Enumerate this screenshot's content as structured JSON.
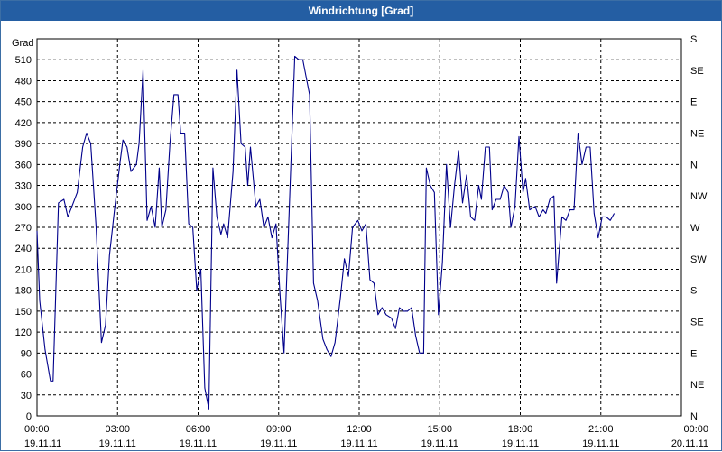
{
  "window": {
    "title": "Windrichtung [Grad]"
  },
  "chart_data": {
    "type": "line",
    "title": "Windrichtung [Grad]",
    "ylabel": "Grad",
    "ylim": [
      0,
      540
    ],
    "xlim": [
      "19.11.11 00:00",
      "20.11.11 00:00"
    ],
    "grid": true,
    "y_ticks": [
      0,
      30,
      60,
      90,
      120,
      150,
      180,
      210,
      240,
      270,
      300,
      330,
      360,
      390,
      420,
      450,
      480,
      510
    ],
    "y2_ticks": [
      {
        "value": 0,
        "label": "N"
      },
      {
        "value": 45,
        "label": "NE"
      },
      {
        "value": 90,
        "label": "E"
      },
      {
        "value": 135,
        "label": "SE"
      },
      {
        "value": 180,
        "label": "S"
      },
      {
        "value": 225,
        "label": "SW"
      },
      {
        "value": 270,
        "label": "W"
      },
      {
        "value": 315,
        "label": "NW"
      },
      {
        "value": 360,
        "label": "N"
      },
      {
        "value": 405,
        "label": "NE"
      },
      {
        "value": 450,
        "label": "E"
      },
      {
        "value": 495,
        "label": "SE"
      },
      {
        "value": 540,
        "label": "S"
      }
    ],
    "x_ticks": [
      {
        "hour": 0,
        "time": "00:00",
        "date": "19.11.11"
      },
      {
        "hour": 3,
        "time": "03:00",
        "date": "19.11.11"
      },
      {
        "hour": 6,
        "time": "06:00",
        "date": "19.11.11"
      },
      {
        "hour": 9,
        "time": "09:00",
        "date": "19.11.11"
      },
      {
        "hour": 12,
        "time": "12:00",
        "date": "19.11.11"
      },
      {
        "hour": 15,
        "time": "15:00",
        "date": "19.11.11"
      },
      {
        "hour": 18,
        "time": "18:00",
        "date": "19.11.11"
      },
      {
        "hour": 21,
        "time": "21:00",
        "date": "19.11.11"
      },
      {
        "hour": 24,
        "time": "00:00",
        "date": "20.11.11"
      }
    ],
    "series": [
      {
        "color": "#00008b",
        "points": [
          [
            0.0,
            265
          ],
          [
            0.1,
            165
          ],
          [
            0.3,
            95
          ],
          [
            0.5,
            50
          ],
          [
            0.6,
            50
          ],
          [
            0.8,
            305
          ],
          [
            1.0,
            310
          ],
          [
            1.15,
            285
          ],
          [
            1.3,
            300
          ],
          [
            1.5,
            320
          ],
          [
            1.7,
            385
          ],
          [
            1.85,
            405
          ],
          [
            2.0,
            390
          ],
          [
            2.2,
            270
          ],
          [
            2.4,
            105
          ],
          [
            2.55,
            130
          ],
          [
            2.7,
            230
          ],
          [
            2.9,
            300
          ],
          [
            3.1,
            365
          ],
          [
            3.2,
            395
          ],
          [
            3.35,
            385
          ],
          [
            3.5,
            350
          ],
          [
            3.7,
            360
          ],
          [
            3.8,
            390
          ],
          [
            3.95,
            495
          ],
          [
            4.1,
            280
          ],
          [
            4.25,
            300
          ],
          [
            4.4,
            270
          ],
          [
            4.55,
            355
          ],
          [
            4.65,
            270
          ],
          [
            4.8,
            295
          ],
          [
            4.95,
            390
          ],
          [
            5.1,
            460
          ],
          [
            5.25,
            460
          ],
          [
            5.35,
            405
          ],
          [
            5.5,
            405
          ],
          [
            5.65,
            275
          ],
          [
            5.8,
            270
          ],
          [
            5.95,
            180
          ],
          [
            6.1,
            210
          ],
          [
            6.25,
            40
          ],
          [
            6.4,
            10
          ],
          [
            6.55,
            355
          ],
          [
            6.7,
            285
          ],
          [
            6.85,
            260
          ],
          [
            6.95,
            275
          ],
          [
            7.1,
            255
          ],
          [
            7.3,
            350
          ],
          [
            7.45,
            495
          ],
          [
            7.6,
            390
          ],
          [
            7.75,
            385
          ],
          [
            7.85,
            330
          ],
          [
            7.95,
            385
          ],
          [
            8.15,
            300
          ],
          [
            8.3,
            310
          ],
          [
            8.45,
            270
          ],
          [
            8.6,
            285
          ],
          [
            8.75,
            255
          ],
          [
            8.9,
            275
          ],
          [
            9.05,
            175
          ],
          [
            9.2,
            90
          ],
          [
            9.4,
            300
          ],
          [
            9.6,
            515
          ],
          [
            9.75,
            510
          ],
          [
            9.9,
            510
          ],
          [
            10.0,
            490
          ],
          [
            10.15,
            460
          ],
          [
            10.3,
            190
          ],
          [
            10.45,
            165
          ],
          [
            10.65,
            110
          ],
          [
            10.8,
            95
          ],
          [
            10.95,
            85
          ],
          [
            11.1,
            105
          ],
          [
            11.3,
            170
          ],
          [
            11.45,
            225
          ],
          [
            11.6,
            200
          ],
          [
            11.75,
            270
          ],
          [
            11.95,
            280
          ],
          [
            12.1,
            265
          ],
          [
            12.25,
            275
          ],
          [
            12.4,
            195
          ],
          [
            12.55,
            190
          ],
          [
            12.7,
            145
          ],
          [
            12.85,
            155
          ],
          [
            13.0,
            145
          ],
          [
            13.2,
            140
          ],
          [
            13.35,
            125
          ],
          [
            13.5,
            155
          ],
          [
            13.65,
            150
          ],
          [
            13.8,
            150
          ],
          [
            13.95,
            155
          ],
          [
            14.1,
            115
          ],
          [
            14.25,
            90
          ],
          [
            14.4,
            90
          ],
          [
            14.5,
            355
          ],
          [
            14.65,
            330
          ],
          [
            14.8,
            320
          ],
          [
            14.95,
            145
          ],
          [
            15.1,
            220
          ],
          [
            15.25,
            360
          ],
          [
            15.4,
            270
          ],
          [
            15.55,
            330
          ],
          [
            15.7,
            380
          ],
          [
            15.85,
            305
          ],
          [
            16.0,
            345
          ],
          [
            16.15,
            285
          ],
          [
            16.3,
            280
          ],
          [
            16.45,
            330
          ],
          [
            16.55,
            310
          ],
          [
            16.7,
            385
          ],
          [
            16.85,
            385
          ],
          [
            16.95,
            295
          ],
          [
            17.1,
            310
          ],
          [
            17.25,
            310
          ],
          [
            17.4,
            330
          ],
          [
            17.55,
            320
          ],
          [
            17.65,
            270
          ],
          [
            17.8,
            300
          ],
          [
            17.95,
            400
          ],
          [
            18.1,
            320
          ],
          [
            18.2,
            340
          ],
          [
            18.35,
            295
          ],
          [
            18.55,
            300
          ],
          [
            18.7,
            285
          ],
          [
            18.85,
            295
          ],
          [
            18.95,
            290
          ],
          [
            19.1,
            310
          ],
          [
            19.25,
            315
          ],
          [
            19.35,
            190
          ],
          [
            19.55,
            285
          ],
          [
            19.7,
            280
          ],
          [
            19.85,
            295
          ],
          [
            20.0,
            295
          ],
          [
            20.15,
            405
          ],
          [
            20.3,
            360
          ],
          [
            20.45,
            385
          ],
          [
            20.6,
            385
          ],
          [
            20.75,
            290
          ],
          [
            20.9,
            255
          ],
          [
            21.05,
            285
          ],
          [
            21.2,
            285
          ],
          [
            21.35,
            280
          ],
          [
            21.5,
            290
          ]
        ]
      }
    ]
  }
}
